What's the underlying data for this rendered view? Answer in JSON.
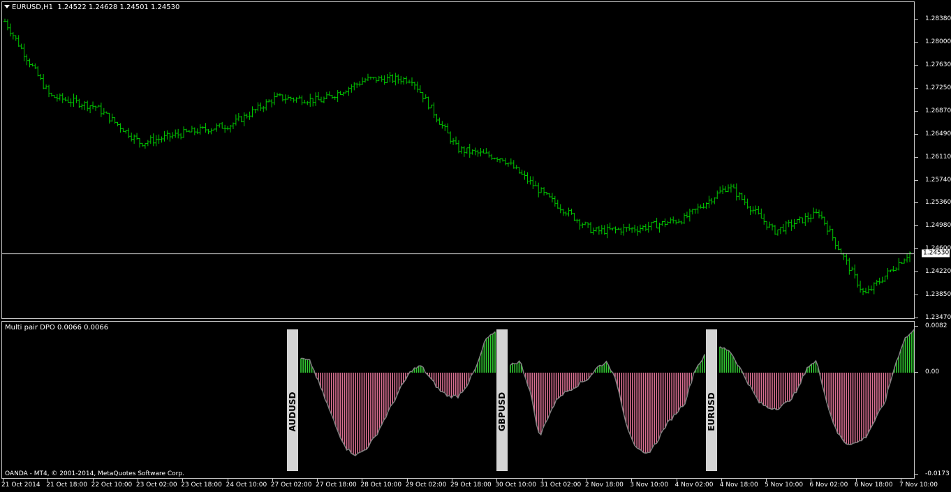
{
  "main": {
    "symbol": "EURUSD,H1",
    "ohlc": "1.24522 1.24628 1.24501 1.24530",
    "current_price": "1.24530",
    "price_axis": [
      "1.28380",
      "1.28000",
      "1.27630",
      "1.27250",
      "1.26870",
      "1.26490",
      "1.26110",
      "1.25740",
      "1.25360",
      "1.24980",
      "1.24600",
      "1.24220",
      "1.23850",
      "1.23470"
    ],
    "colors": {
      "bar": "#00c800",
      "price_line": "#c8c8c8"
    }
  },
  "indicator": {
    "title": "Multi pair DPO 0.0066 0.0066",
    "axis": [
      "0.0082",
      "0.00",
      "-0.0173"
    ],
    "pairs": [
      "AUDUSD",
      "GBPUSD",
      "EURUSD"
    ],
    "colors": {
      "positive": "#32cd32",
      "negative": "#db7093",
      "outline": "#808080"
    }
  },
  "time_axis": [
    "21 Oct 2014",
    "21 Oct 18:00",
    "22 Oct 10:00",
    "23 Oct 02:00",
    "23 Oct 18:00",
    "24 Oct 10:00",
    "27 Oct 02:00",
    "27 Oct 18:00",
    "28 Oct 10:00",
    "29 Oct 02:00",
    "29 Oct 18:00",
    "30 Oct 10:00",
    "31 Oct 02:00",
    "2 Nov 18:00",
    "3 Nov 10:00",
    "4 Nov 02:00",
    "4 Nov 18:00",
    "5 Nov 10:00",
    "6 Nov 02:00",
    "6 Nov 18:00",
    "7 Nov 10:00"
  ],
  "footer": {
    "copyright": "OANDA - MT4, © 2001-2014, MetaQuotes Software Corp."
  },
  "chart_data": [
    {
      "type": "line",
      "title": "EURUSD,H1",
      "x": [
        "21 Oct 2014",
        "21 Oct 18:00",
        "22 Oct 10:00",
        "23 Oct 02:00",
        "23 Oct 18:00",
        "24 Oct 10:00",
        "27 Oct 02:00",
        "27 Oct 18:00",
        "28 Oct 10:00",
        "29 Oct 02:00",
        "29 Oct 18:00",
        "30 Oct 10:00",
        "31 Oct 02:00",
        "2 Nov 18:00",
        "3 Nov 10:00",
        "4 Nov 02:00",
        "4 Nov 18:00",
        "5 Nov 10:00",
        "6 Nov 02:00",
        "6 Nov 18:00",
        "7 Nov 10:00"
      ],
      "series": [
        {
          "values": [
            1.2835,
            1.2712,
            1.2695,
            1.2635,
            1.2652,
            1.2665,
            1.271,
            1.2705,
            1.274,
            1.274,
            1.2625,
            1.261,
            1.2545,
            1.249,
            1.2495,
            1.251,
            1.2565,
            1.249,
            1.252,
            1.2385,
            1.2455
          ]
        }
      ],
      "ylim": [
        1.2347,
        1.2838
      ]
    },
    {
      "type": "bar",
      "title": "Multi pair DPO 0.0066 0.0066",
      "ylim": [
        -0.0173,
        0.0082
      ],
      "series": [
        {
          "name": "AUDUSD",
          "values": [
            0.0025,
            0.002,
            -0.002,
            -0.006,
            -0.01,
            -0.013,
            -0.014,
            -0.013,
            -0.011,
            -0.008,
            -0.005,
            -0.002,
            0.0005,
            0.0012,
            -0.001,
            -0.003,
            -0.004,
            -0.004,
            -0.002,
            0.001,
            0.006,
            0.007
          ]
        },
        {
          "name": "GBPUSD",
          "values": [
            0.0015,
            0.002,
            -0.003,
            -0.011,
            -0.007,
            -0.004,
            -0.003,
            -0.002,
            -0.001,
            0.001,
            0.002,
            -0.002,
            -0.009,
            -0.013,
            -0.014,
            -0.012,
            -0.009,
            -0.007,
            -0.005,
            0.0005,
            0.003
          ]
        },
        {
          "name": "EURUSD",
          "values": [
            0.0045,
            0.004,
            0.001,
            -0.002,
            -0.005,
            -0.006,
            -0.006,
            -0.005,
            -0.003,
            0.001,
            0.002,
            -0.005,
            -0.01,
            -0.012,
            -0.012,
            -0.011,
            -0.008,
            -0.005,
            0.001,
            0.006,
            0.0075
          ]
        }
      ]
    }
  ]
}
